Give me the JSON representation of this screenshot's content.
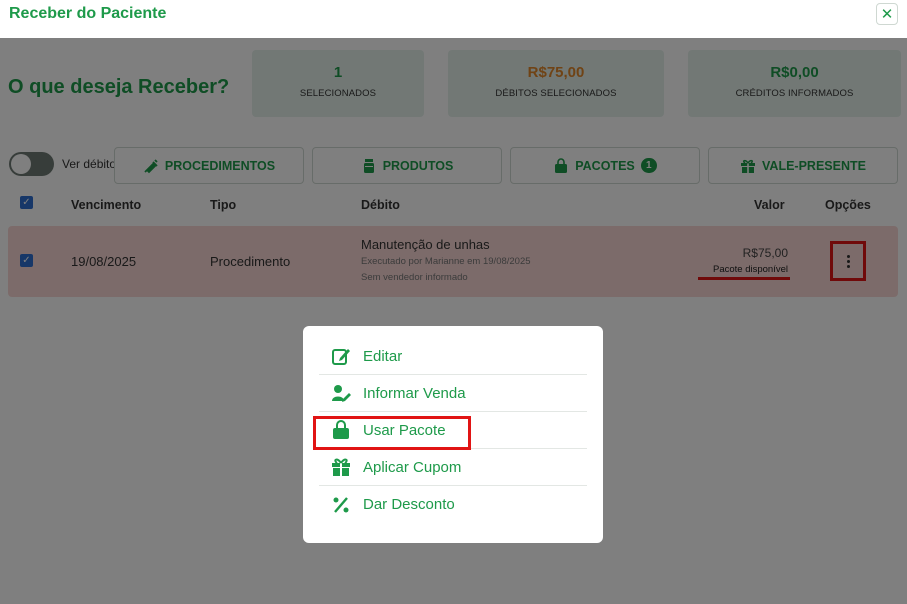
{
  "window": {
    "title": "Receber do Paciente",
    "close_icon": "close-icon"
  },
  "headline": "O que deseja Receber?",
  "stats": [
    {
      "value": "1",
      "label": "SELECIONADOS",
      "color": "#1e9a4a"
    },
    {
      "value": "R$75,00",
      "label": "DÉBITOS SELECIONADOS",
      "color": "#e0862a"
    },
    {
      "value": "R$0,00",
      "label": "CRÉDITOS INFORMADOS",
      "color": "#1e9a4a"
    }
  ],
  "toggle_label": "Ver débitos",
  "tabs": [
    {
      "label": "PROCEDIMENTOS",
      "icon": "syringe-icon"
    },
    {
      "label": "PRODUTOS",
      "icon": "bottle-icon"
    },
    {
      "label": "PACOTES",
      "icon": "shopping-bag-icon",
      "badge": "1"
    },
    {
      "label": "VALE-PRESENTE",
      "icon": "gift-icon"
    }
  ],
  "table": {
    "headers": {
      "vencimento": "Vencimento",
      "tipo": "Tipo",
      "debito": "Débito",
      "valor": "Valor",
      "opcoes": "Opções"
    },
    "rows": [
      {
        "vencimento": "19/08/2025",
        "tipo": "Procedimento",
        "debito": "Manutenção de unhas",
        "detail1": "Executado por Marianne em 19/08/2025",
        "detail2": "Sem vendedor informado",
        "valor": "R$75,00",
        "pacote": "Pacote disponível"
      }
    ]
  },
  "menu": [
    {
      "label": "Editar",
      "icon": "edit-icon"
    },
    {
      "label": "Informar Venda",
      "icon": "user-edit-icon"
    },
    {
      "label": "Usar Pacote",
      "icon": "shopping-bag-icon"
    },
    {
      "label": "Aplicar Cupom",
      "icon": "gift-icon"
    },
    {
      "label": "Dar Desconto",
      "icon": "percent-icon"
    }
  ],
  "colors": {
    "accent": "#1e9a4a",
    "warning": "#e0862a",
    "highlight": "#e11414",
    "row_bg": "#f8d7d5"
  }
}
